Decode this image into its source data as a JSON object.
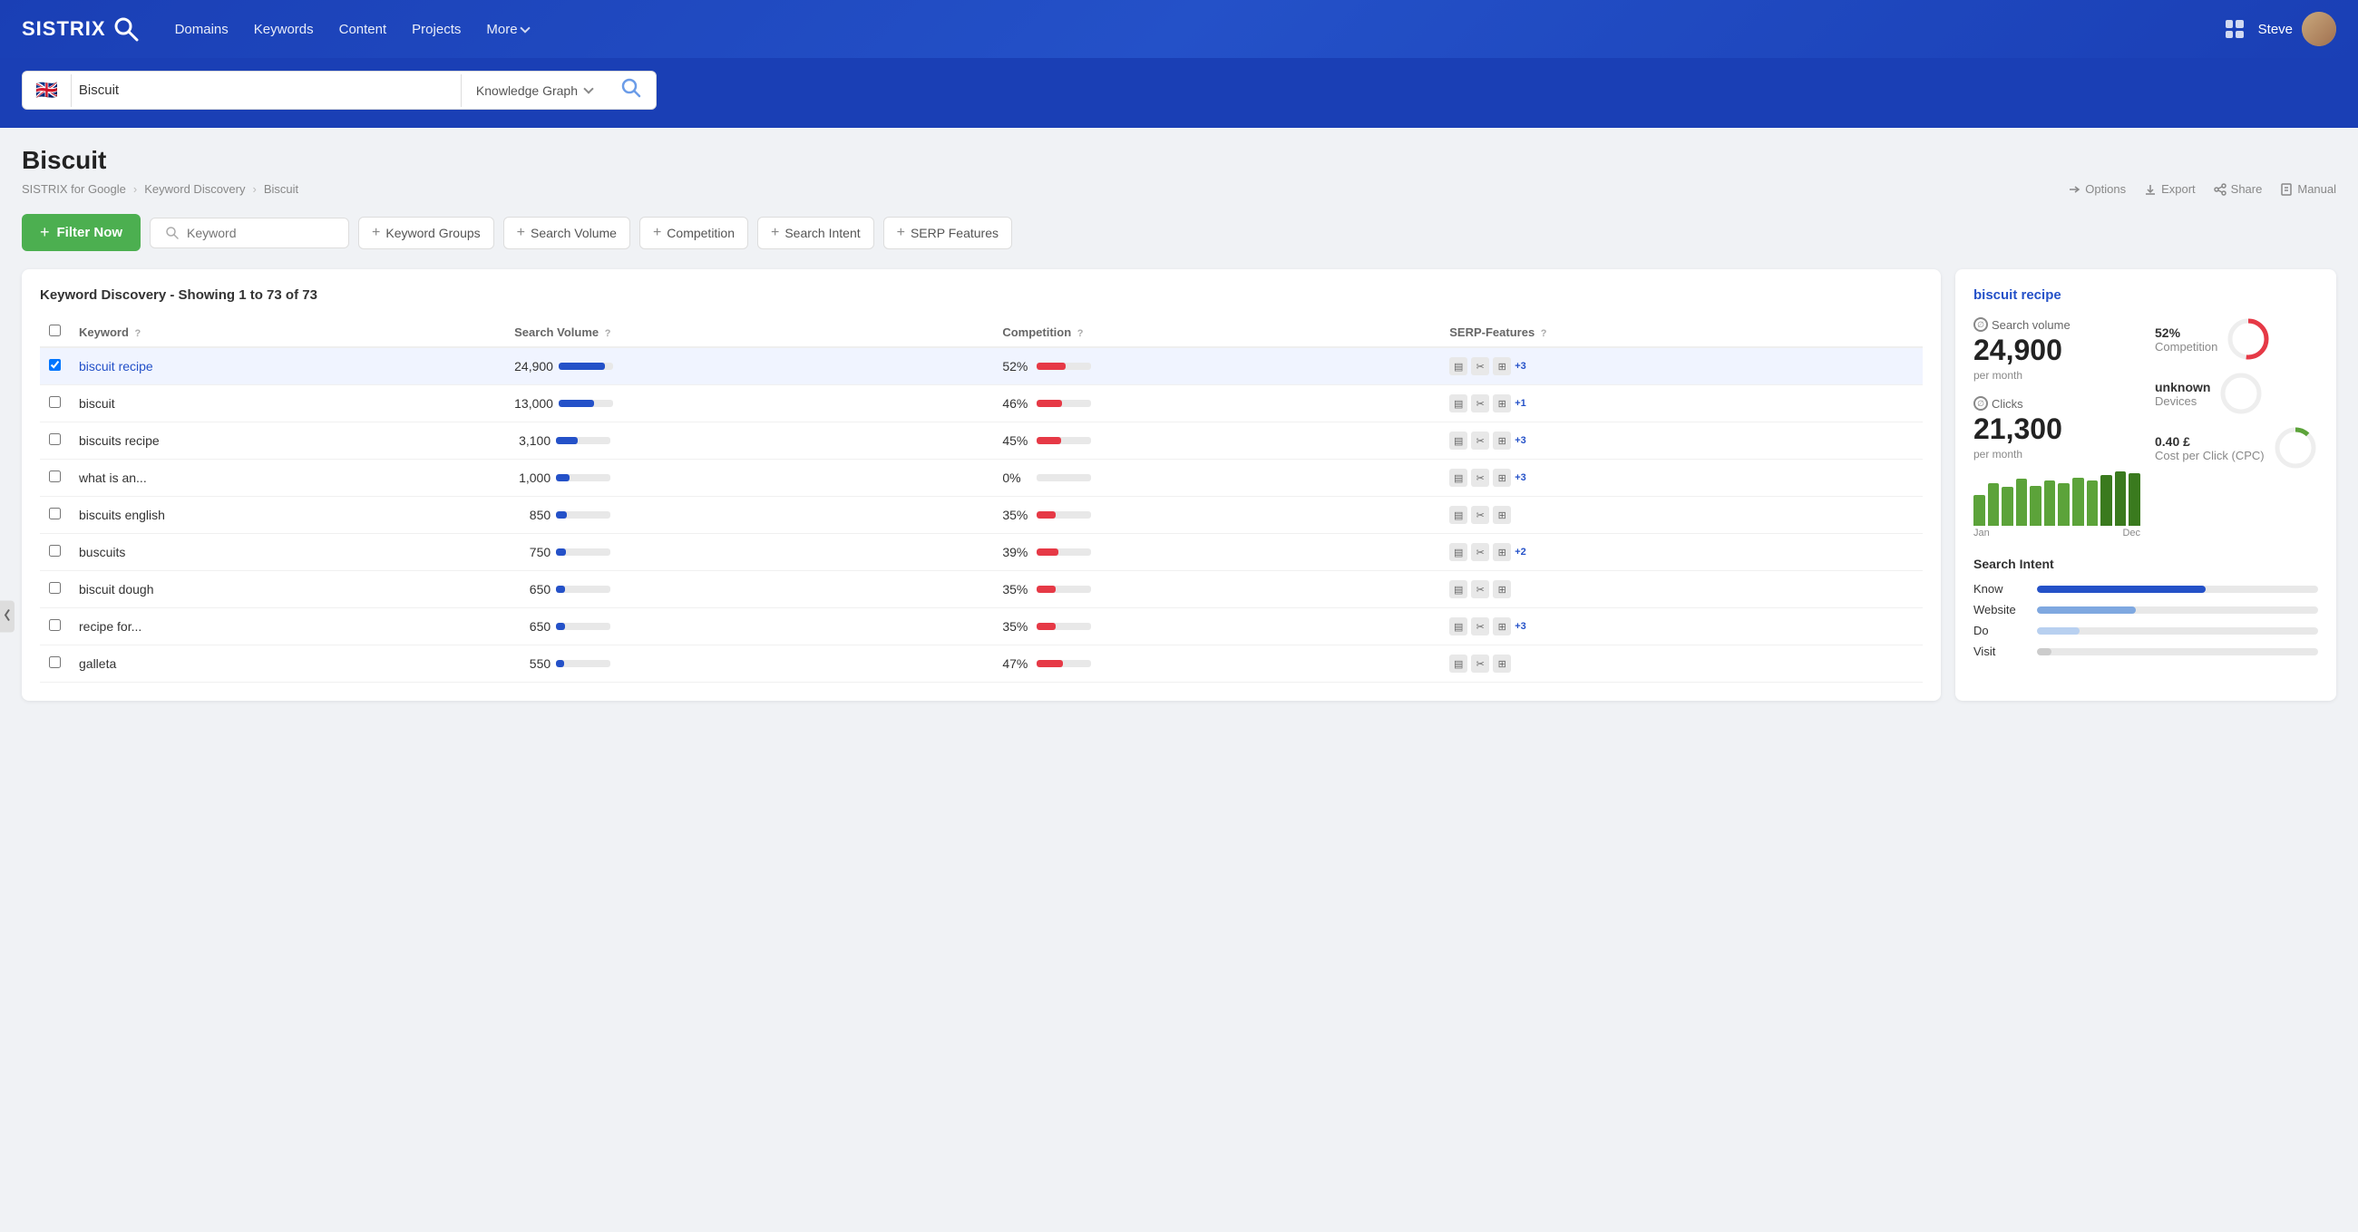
{
  "nav": {
    "logo": "SISTRIX",
    "links": [
      "Domains",
      "Keywords",
      "Content",
      "Projects",
      "More"
    ],
    "user": "Steve"
  },
  "search": {
    "flag": "🇬🇧",
    "query": "Biscuit",
    "type": "Knowledge Graph",
    "placeholder": "Keyword"
  },
  "page": {
    "title": "Biscuit",
    "breadcrumb": [
      "SISTRIX for Google",
      "Keyword Discovery",
      "Biscuit"
    ],
    "actions": [
      "Options",
      "Export",
      "Share",
      "Manual"
    ]
  },
  "filters": {
    "filter_now": "Filter Now",
    "keyword_placeholder": "Keyword",
    "pills": [
      "Keyword Groups",
      "Search Volume",
      "Competition",
      "Search Intent",
      "SERP Features"
    ]
  },
  "table": {
    "title": "Keyword Discovery - Showing 1 to 73 of 73",
    "headers": [
      "Keyword",
      "Search Volume",
      "Competition",
      "SERP-Features"
    ],
    "rows": [
      {
        "keyword": "biscuit recipe",
        "sv": 24900,
        "sv_pct": 85,
        "comp": "52%",
        "comp_pct": 52,
        "serp_extra": "+3",
        "selected": true
      },
      {
        "keyword": "biscuit",
        "sv": 13000,
        "sv_pct": 65,
        "comp": "46%",
        "comp_pct": 46,
        "serp_extra": "+1",
        "selected": false
      },
      {
        "keyword": "biscuits recipe",
        "sv": 3100,
        "sv_pct": 40,
        "comp": "45%",
        "comp_pct": 45,
        "serp_extra": "+3",
        "selected": false
      },
      {
        "keyword": "what is an...",
        "sv": 1000,
        "sv_pct": 25,
        "comp": "0%",
        "comp_pct": 0,
        "serp_extra": "+3",
        "selected": false
      },
      {
        "keyword": "biscuits english",
        "sv": 850,
        "sv_pct": 20,
        "comp": "35%",
        "comp_pct": 35,
        "serp_extra": "",
        "selected": false
      },
      {
        "keyword": "buscuits",
        "sv": 750,
        "sv_pct": 18,
        "comp": "39%",
        "comp_pct": 39,
        "serp_extra": "+2",
        "selected": false
      },
      {
        "keyword": "biscuit dough",
        "sv": 650,
        "sv_pct": 16,
        "comp": "35%",
        "comp_pct": 35,
        "serp_extra": "",
        "selected": false
      },
      {
        "keyword": "recipe for...",
        "sv": 650,
        "sv_pct": 16,
        "comp": "35%",
        "comp_pct": 35,
        "serp_extra": "+3",
        "selected": false
      },
      {
        "keyword": "galleta",
        "sv": 550,
        "sv_pct": 14,
        "comp": "47%",
        "comp_pct": 47,
        "serp_extra": "",
        "selected": false
      }
    ]
  },
  "detail": {
    "keyword": "biscuit recipe",
    "search_volume": "24,900",
    "search_volume_label": "Search volume",
    "search_volume_sub": "per month",
    "clicks": "21,300",
    "clicks_label": "Clicks",
    "clicks_sub": "per month",
    "competition_value": "52%",
    "competition_label": "Competition",
    "devices_value": "unknown",
    "devices_label": "Devices",
    "cpc_value": "0.40 £",
    "cpc_label": "Cost per Click (CPC)",
    "chart_labels": [
      "Jan",
      "Dec"
    ],
    "chart_bars": [
      40,
      55,
      50,
      60,
      52,
      58,
      55,
      62,
      58,
      65,
      70,
      68
    ],
    "search_intent_title": "Search Intent",
    "intent_rows": [
      {
        "label": "Know",
        "pct": 60,
        "style": "blue"
      },
      {
        "label": "Website",
        "pct": 35,
        "style": "lblue"
      },
      {
        "label": "Do",
        "pct": 15,
        "style": "llblue"
      },
      {
        "label": "Visit",
        "pct": 5,
        "style": "gray"
      }
    ]
  }
}
